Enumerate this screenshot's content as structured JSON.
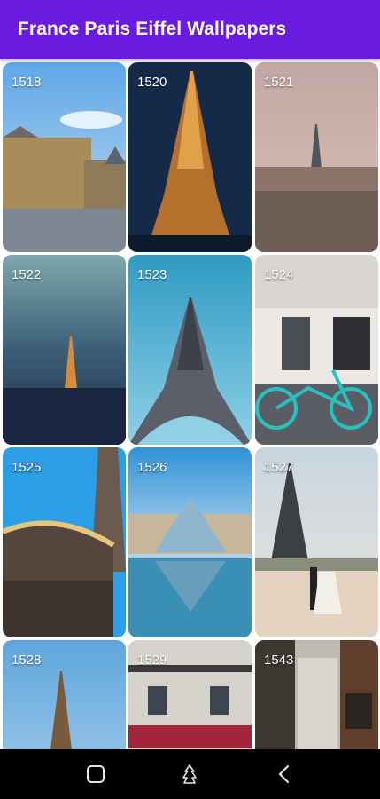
{
  "app": {
    "title": "France Paris Eiffel Wallpapers"
  },
  "colors": {
    "appbar": "#6a1be0",
    "navbar": "#000000"
  },
  "wallpapers": [
    {
      "number": "1518",
      "scene": "louvre-palace"
    },
    {
      "number": "1520",
      "scene": "eiffel-tower-night"
    },
    {
      "number": "1521",
      "scene": "paris-skyline"
    },
    {
      "number": "1522",
      "scene": "foggy-paris"
    },
    {
      "number": "1523",
      "scene": "eiffel-tower-blue-sky"
    },
    {
      "number": "1524",
      "scene": "bicycle-storefront"
    },
    {
      "number": "1525",
      "scene": "carousel"
    },
    {
      "number": "1526",
      "scene": "louvre-pyramid-reflection"
    },
    {
      "number": "1527",
      "scene": "wedding-couple-trocadero"
    },
    {
      "number": "1528",
      "scene": "eiffel-tower-blue"
    },
    {
      "number": "1529",
      "scene": "parisian-building"
    },
    {
      "number": "1543",
      "scene": "street-corner"
    }
  ],
  "system_nav": {
    "recents_icon": "square-icon",
    "home_icon": "tree-icon",
    "back_icon": "chevron-left-icon"
  }
}
